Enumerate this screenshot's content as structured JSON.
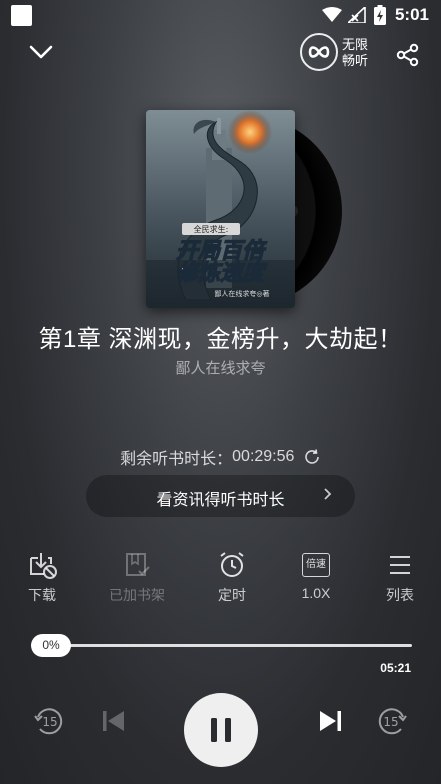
{
  "status_bar": {
    "time": "5:01"
  },
  "top_bar": {
    "unlimited_label": "无限畅听"
  },
  "book": {
    "chapter_title": "第1章 深渊现，金榜升，大劫起！",
    "author": "鄙人在线求夸"
  },
  "listening": {
    "remaining_label": "剩余听书时长：",
    "remaining_time": "00:29:56",
    "ad_button_label": "看资讯得听书时长"
  },
  "tools": {
    "download": "下载",
    "bookshelf": "已加书架",
    "timer": "定时",
    "speed_icon_text": "倍速",
    "speed": "1.0X",
    "list": "列表"
  },
  "player": {
    "progress_label": "0%",
    "progress": 0,
    "duration": "05:21",
    "rewind_seconds": "15",
    "forward_seconds": "15"
  },
  "colors": {
    "background": "#3d4045",
    "accent": "#ffffff",
    "play_button": "#efefef"
  }
}
